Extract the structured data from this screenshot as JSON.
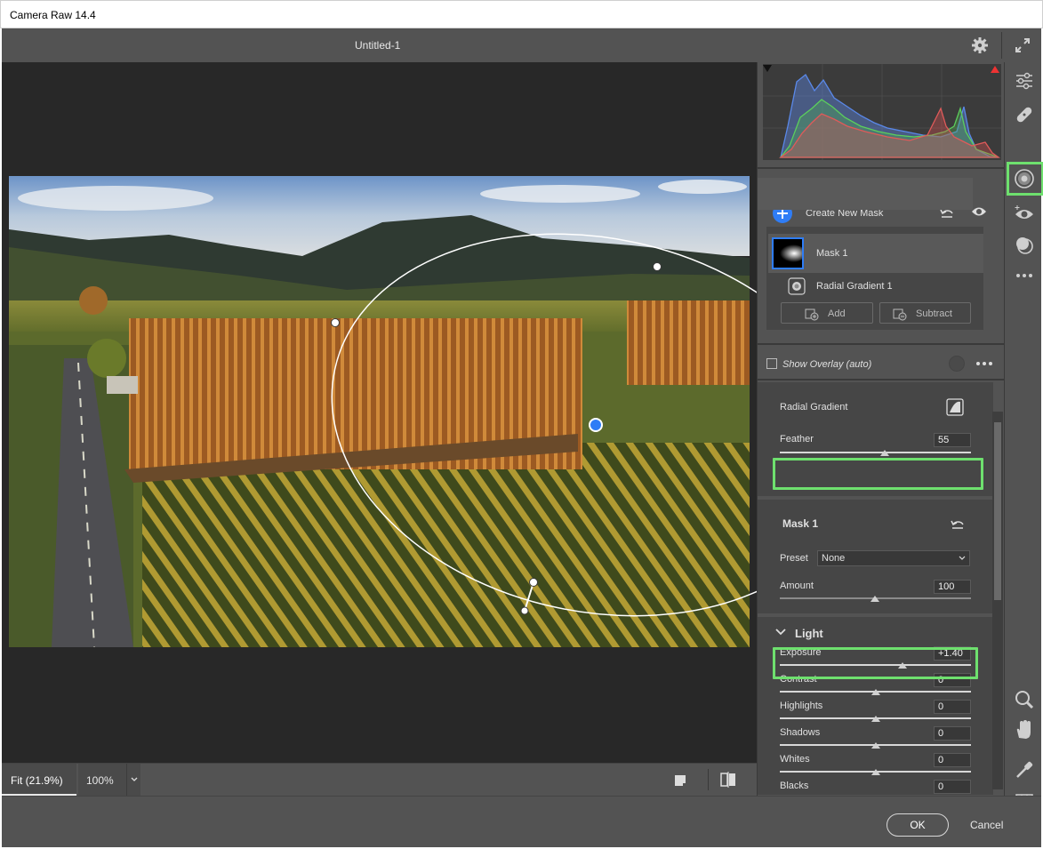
{
  "window": {
    "title": "Camera Raw 14.4"
  },
  "header": {
    "document_title": "Untitled-1"
  },
  "masks": {
    "create_new_label": "Create New Mask",
    "mask_name": "Mask 1",
    "component_name": "Radial Gradient 1",
    "add_label": "Add",
    "subtract_label": "Subtract",
    "show_overlay_label": "Show Overlay (auto)"
  },
  "radial": {
    "title": "Radial Gradient",
    "feather_label": "Feather",
    "feather_value": "55",
    "feather_fraction": 0.55
  },
  "mask_settings": {
    "title": "Mask 1",
    "preset_label": "Preset",
    "preset_value": "None",
    "amount_label": "Amount",
    "amount_value": "100"
  },
  "light": {
    "title": "Light",
    "sliders": [
      {
        "label": "Exposure",
        "value": "+1.40",
        "fraction": 0.64
      },
      {
        "label": "Contrast",
        "value": "0",
        "fraction": 0.5
      },
      {
        "label": "Highlights",
        "value": "0",
        "fraction": 0.5
      },
      {
        "label": "Shadows",
        "value": "0",
        "fraction": 0.5
      },
      {
        "label": "Whites",
        "value": "0",
        "fraction": 0.5
      },
      {
        "label": "Blacks",
        "value": "0",
        "fraction": 0.5
      }
    ]
  },
  "zoom": {
    "fit_label": "Fit (21.9%)",
    "hundred_label": "100%"
  },
  "footer": {
    "ok_label": "OK",
    "cancel_label": "Cancel"
  },
  "colors": {
    "highlight": "#6ee06e",
    "accent": "#2f7df6",
    "panel_bg": "#535353",
    "canvas_bg": "#282828"
  },
  "icons": {
    "header": [
      "gear-icon",
      "expand-icon"
    ],
    "tools": [
      "edit-sliders-icon",
      "healing-icon",
      "masking-icon",
      "red-eye-icon",
      "presets-icon",
      "more-icon",
      "zoom-icon",
      "hand-icon",
      "color-sampler-icon",
      "grid-icon"
    ]
  }
}
